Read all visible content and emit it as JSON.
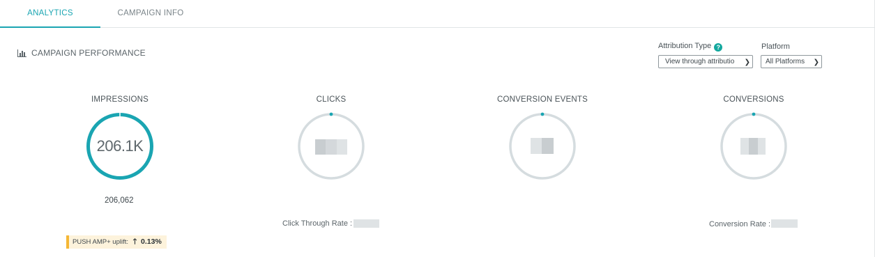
{
  "tabs": [
    {
      "label": "ANALYTICS",
      "active": true
    },
    {
      "label": "CAMPAIGN INFO",
      "active": false
    }
  ],
  "section": {
    "title": "CAMPAIGN PERFORMANCE",
    "icon": "bar-chart-icon"
  },
  "filters": {
    "attribution": {
      "label": "Attribution Type",
      "help_icon": "?",
      "value": "View through attributio"
    },
    "platform": {
      "label": "Platform",
      "value": "All Platforms"
    }
  },
  "metrics": [
    {
      "title": "IMPRESSIONS",
      "value_display": "206.1K",
      "exact_value": "206,062",
      "ring_progress": 1.0
    },
    {
      "title": "CLICKS",
      "value_display": "",
      "ring_progress": 0.0,
      "rate_label": "Click Through Rate :"
    },
    {
      "title": "CONVERSION EVENTS",
      "value_display": "",
      "ring_progress": 0.0
    },
    {
      "title": "CONVERSIONS",
      "value_display": "",
      "ring_progress": 0.0,
      "rate_label": "Conversion Rate :"
    }
  ],
  "uplift": {
    "label": "PUSH AMP+ uplift:",
    "arrow": "🡑",
    "value": "0.13%"
  },
  "colors": {
    "accent": "#1aa5b2",
    "ring_track": "#d5dcdf",
    "uplift_bar": "#f5b735",
    "uplift_bg": "#fdf3dc"
  }
}
